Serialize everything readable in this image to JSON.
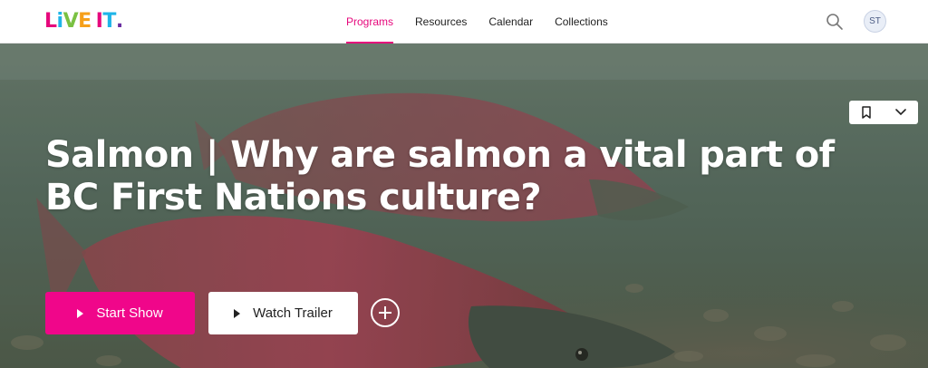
{
  "header": {
    "logo_text": "LIVE IT.",
    "logo_letters": [
      {
        "char": "L",
        "color": "#e6087c"
      },
      {
        "char": "i",
        "color": "#1fb5e8"
      },
      {
        "char": "V",
        "color": "#7ac142"
      },
      {
        "char": "E",
        "color": "#f6a01a"
      },
      {
        "char": " ",
        "color": "#000000"
      },
      {
        "char": "I",
        "color": "#e6087c"
      },
      {
        "char": "T",
        "color": "#1fb5e8"
      },
      {
        "char": ".",
        "color": "#6a2ea0"
      }
    ],
    "nav": [
      {
        "label": "Programs",
        "active": true
      },
      {
        "label": "Resources",
        "active": false
      },
      {
        "label": "Calendar",
        "active": false
      },
      {
        "label": "Collections",
        "active": false
      }
    ],
    "search_icon": "search-icon",
    "avatar_initials": "ST"
  },
  "hero": {
    "title": "Salmon | Why are salmon a vital part of BC First Nations culture?",
    "start_label": "Start Show",
    "trailer_label": "Watch Trailer",
    "accent_color": "#f0068a"
  }
}
